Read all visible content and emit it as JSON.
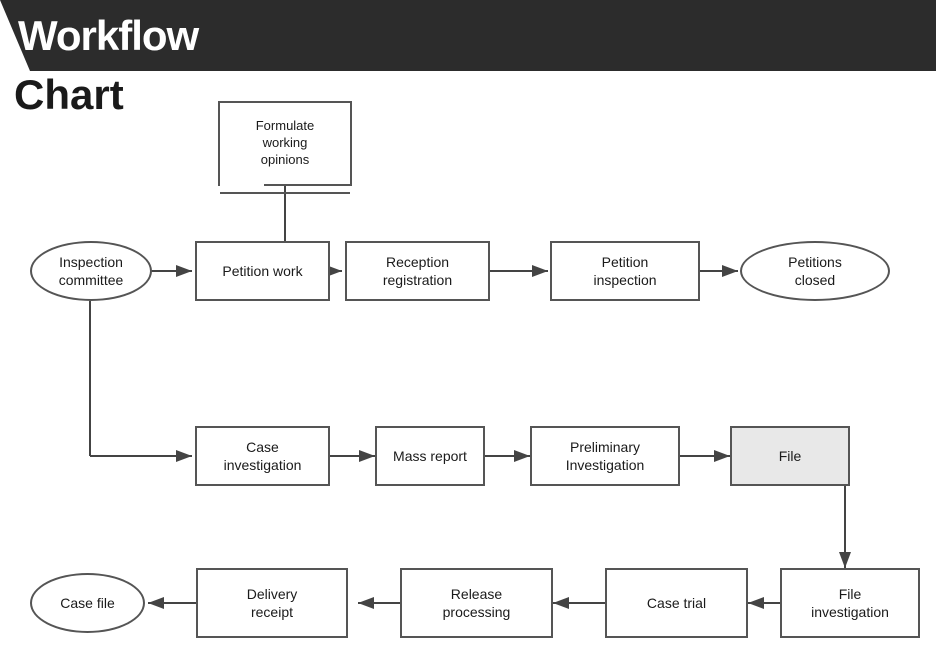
{
  "header": {
    "title": "Workflow",
    "subtitle": "Chart"
  },
  "nodes": {
    "formulate": {
      "label": "Formulate\nworking\nopinions"
    },
    "inspection_committee": {
      "label": "Inspection\ncommittee"
    },
    "petition_work": {
      "label": "Petition work"
    },
    "reception_registration": {
      "label": "Reception\nregistration"
    },
    "petition_inspection": {
      "label": "Petition\ninspection"
    },
    "petitions_closed": {
      "label": "Petitions\nclosed"
    },
    "case_investigation": {
      "label": "Case\ninvestigation"
    },
    "mass_report": {
      "label": "Mass report"
    },
    "preliminary_investigation": {
      "label": "Preliminary\nInvestigation"
    },
    "file": {
      "label": "File"
    },
    "file_investigation": {
      "label": "File\ninvestigation"
    },
    "case_trial": {
      "label": "Case trial"
    },
    "release_processing": {
      "label": "Release\nprocessing"
    },
    "delivery_receipt": {
      "label": "Delivery\nreceipt"
    },
    "case_file": {
      "label": "Case file"
    }
  }
}
